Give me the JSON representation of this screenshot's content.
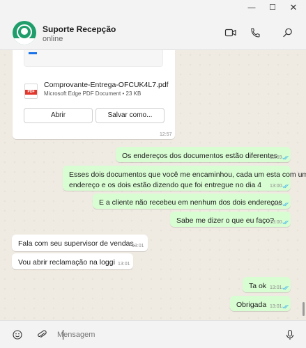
{
  "window": {
    "minimize_glyph": "—",
    "maximize_glyph": "☐",
    "close_glyph": "✕"
  },
  "contact": {
    "name": "Suporte Recepção",
    "status": "online"
  },
  "header_icons": [
    "video-call-icon",
    "phone-icon",
    "search-icon"
  ],
  "document": {
    "filename": "Comprovante-Entrega-OFCUK4L7.pdf",
    "meta": "Microsoft Edge PDF Document • 23 KB",
    "icon_tag": "PDF",
    "open_label": "Abrir",
    "save_label": "Salvar como...",
    "time": "12:57"
  },
  "messages": [
    {
      "direction": "out",
      "text": [
        "Os endereços dos documentos estão diferentes"
      ],
      "time": "12:59",
      "read": true
    },
    {
      "direction": "out",
      "text": [
        "Esses dois documentos que você me encaminhou, cada um esta com um",
        "endereço e os dois estão dizendo que foi entregue no dia 4"
      ],
      "time": "13:00",
      "read": true
    },
    {
      "direction": "out",
      "text": [
        "E a cliente não recebeu em nenhum dos dois endereços"
      ],
      "time": "13:00",
      "read": true
    },
    {
      "direction": "out",
      "text": [
        "Sabe me dizer o que eu faço?"
      ],
      "time": "13:00",
      "read": true
    },
    {
      "direction": "in",
      "text": [
        "Fala com seu supervisor de vendas."
      ],
      "time": "13:01"
    },
    {
      "direction": "in",
      "text": [
        "Vou abrir reclamação na loggi"
      ],
      "time": "13:01"
    },
    {
      "direction": "out",
      "text": [
        "Ta ok"
      ],
      "time": "13:01",
      "read": true
    },
    {
      "direction": "out",
      "text": [
        "Obrigada"
      ],
      "time": "13:01",
      "read": true
    }
  ],
  "composer": {
    "placeholder": "Mensagem",
    "value": ""
  },
  "colors": {
    "outgoing_bubble": "#d9fdd3",
    "incoming_bubble": "#ffffff",
    "chat_background": "#efeae2",
    "read_check": "#53bdeb",
    "avatar": "#1f9e6b"
  }
}
